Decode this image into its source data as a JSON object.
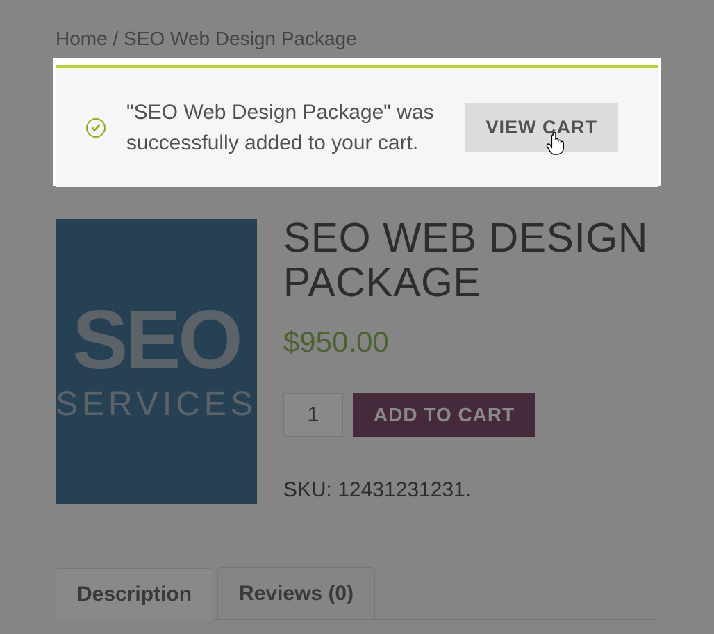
{
  "breadcrumb": {
    "home": "Home",
    "separator": "/",
    "current": "SEO Web Design Package"
  },
  "notice": {
    "message": "\"SEO Web Design Package\" was successfully added to your cart.",
    "button_label": "VIEW CART"
  },
  "product": {
    "title": "SEO WEB DESIGN PACKAGE",
    "currency": "$",
    "price": "950.00",
    "quantity": "1",
    "add_to_cart_label": "ADD TO CART",
    "sku_label": "SKU:",
    "sku_value": "12431231231",
    "image_text_line1": "SEO",
    "image_text_line2": "SERVICES"
  },
  "tabs": {
    "description_label": "Description",
    "reviews_label": "Reviews (0)"
  },
  "colors": {
    "accent_green": "#8fae1b",
    "price_green": "#7aa93c",
    "button_purple": "#6a2c50",
    "image_bg": "#25608a"
  }
}
